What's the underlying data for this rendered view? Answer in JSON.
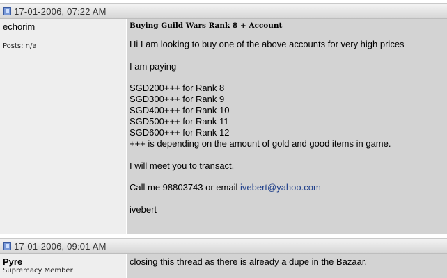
{
  "posts": [
    {
      "date": "17-01-2006, 07:22 AM",
      "username": "echorim",
      "posts_label": "Posts: n/a",
      "title": "Buying Guild Wars Rank 8 + Account",
      "line1": "Hi I am looking to buy one of the above accounts for very high prices",
      "line2": "I am paying",
      "prices": [
        "SGD200+++ for Rank 8",
        "SGD300+++ for Rank 9",
        "SGD400+++ for Rank 10",
        "SGD500+++ for Rank 11",
        "SGD600+++ for Rank 12"
      ],
      "line3": "+++ is depending on the amount of gold and good items in game.",
      "line4": "I will meet you to transact.",
      "call_prefix": "Call me 98803743 or email ",
      "email": "ivebert@yahoo.com",
      "signoff": "ivebert"
    },
    {
      "date": "17-01-2006, 09:01 AM",
      "username": "Pyre",
      "user_title": "Supremacy Member",
      "line1": "closing this thread as there is already a dupe in the Bazaar."
    }
  ]
}
